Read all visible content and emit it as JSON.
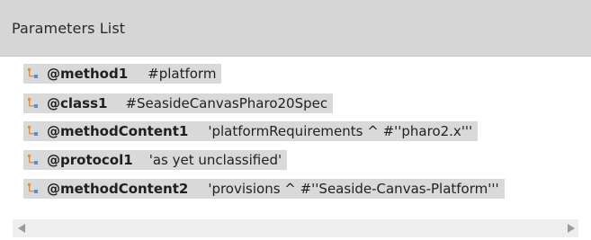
{
  "header": {
    "title": "Parameters List"
  },
  "parameters": [
    {
      "name": "@method1",
      "value": "#platform"
    },
    {
      "name": "@class1",
      "value": "#SeasideCanvasPharo20Spec"
    },
    {
      "name": "@methodContent1",
      "value": "'platformRequirements  ^ #''pharo2.x'''"
    },
    {
      "name": "@protocol1",
      "value": "'as yet unclassified'"
    },
    {
      "name": "@methodContent2",
      "value": "'provisions   ^ #''Seaside-Canvas-Platform'''"
    }
  ],
  "icons": {
    "item": "parameter-node-icon",
    "scroll_left": "scroll-left-arrow-icon",
    "scroll_right": "scroll-right-arrow-icon"
  },
  "colors": {
    "header_bg": "#d6d6d6",
    "row_bg": "#d9d9d9",
    "icon_orange": "#e8912e",
    "icon_blue": "#5b8fd4"
  }
}
